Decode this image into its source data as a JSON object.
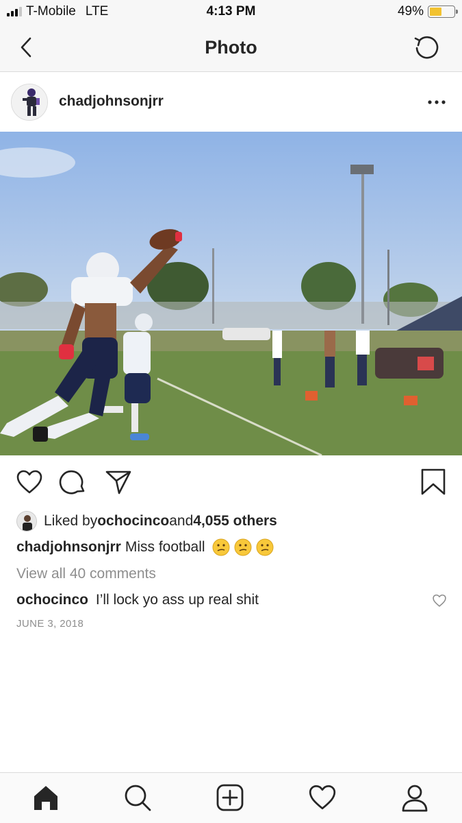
{
  "status_bar": {
    "carrier": "T-Mobile",
    "network": "LTE",
    "time": "4:13 PM",
    "battery_text": "49%",
    "battery_level": 0.49,
    "battery_color": "#f2c230"
  },
  "nav": {
    "title": "Photo",
    "back_icon": "chevron-left-icon",
    "refresh_icon": "refresh-icon"
  },
  "post": {
    "username": "chadjohnsonjrr",
    "more_icon": "more-horizontal-icon",
    "likes": {
      "prefix": "Liked by ",
      "liker": "ochocinco",
      "middle": " and ",
      "count": "4,055 others"
    },
    "caption": {
      "username": "chadjohnsonjrr",
      "text": "Miss football",
      "emojis": [
        "confused-face",
        "confused-face",
        "confused-face"
      ]
    },
    "view_comments": "View all 40 comments",
    "comment": {
      "username": "ochocinco",
      "text": "I’ll lock yo ass up real shit"
    },
    "date": "JUNE 3, 2018"
  },
  "actions": [
    "heart-icon",
    "comment-icon",
    "share-icon",
    "bookmark-icon"
  ],
  "tabs": [
    "home-icon",
    "search-icon",
    "add-post-icon",
    "activity-heart-icon",
    "profile-icon"
  ]
}
